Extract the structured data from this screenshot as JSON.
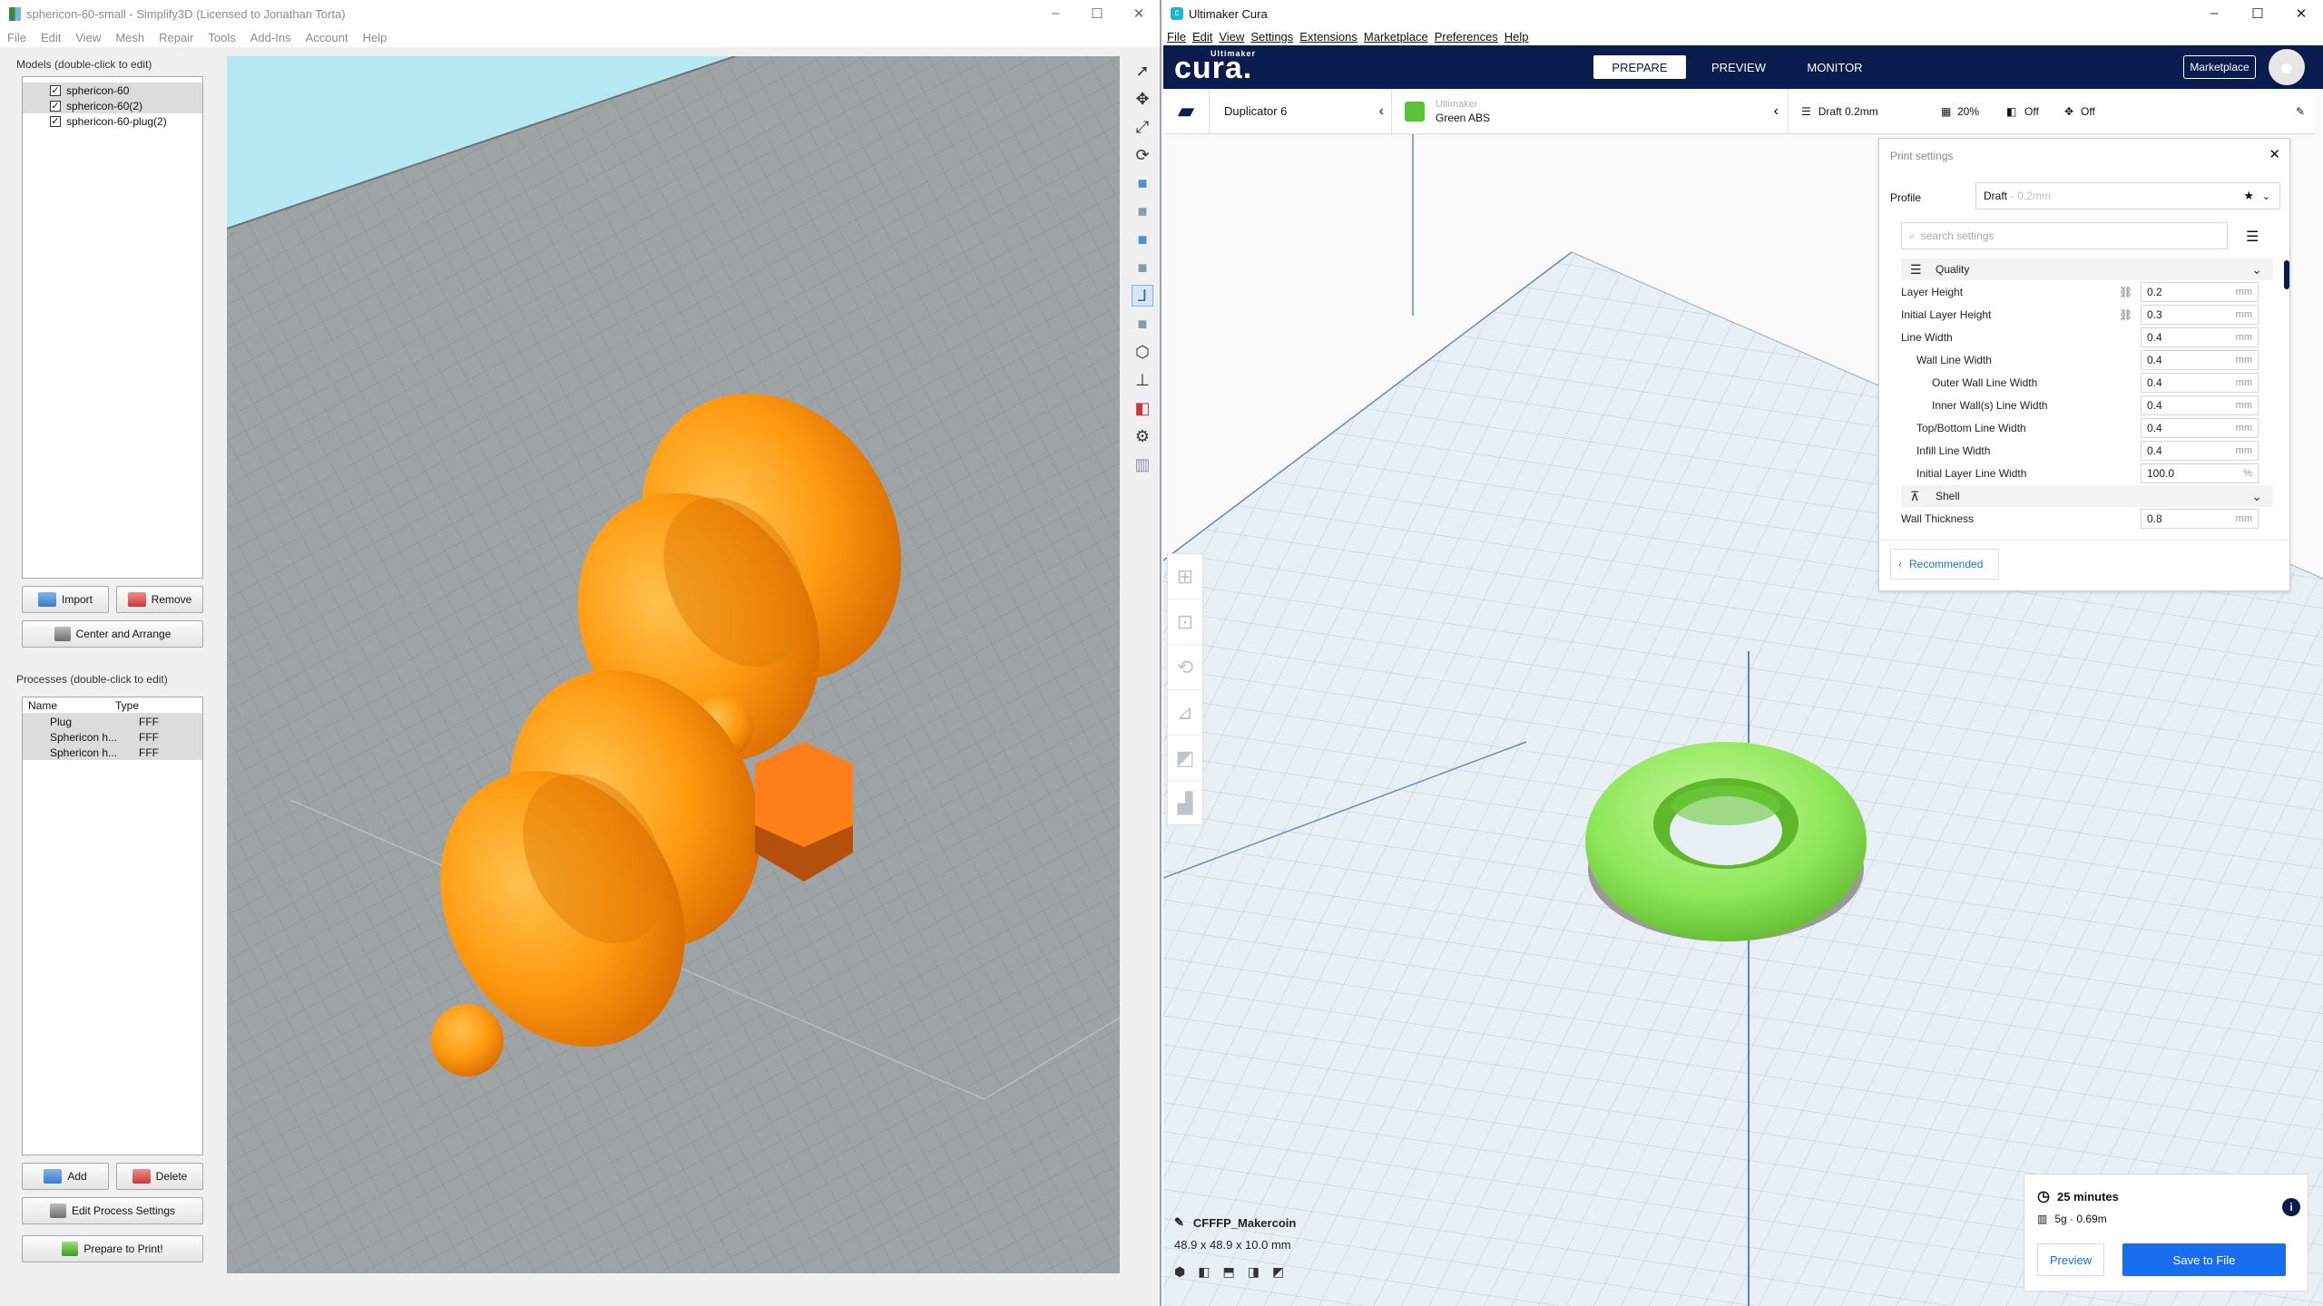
{
  "simplify3d": {
    "title": "sphericon-60-small - Simplify3D (Licensed to Jonathan Torta)",
    "menu": [
      "File",
      "Edit",
      "View",
      "Mesh",
      "Repair",
      "Tools",
      "Add-Ins",
      "Account",
      "Help"
    ],
    "models_label": "Models (double-click to edit)",
    "models": [
      {
        "name": "sphericon-60",
        "checked": "✓"
      },
      {
        "name": "sphericon-60(2)",
        "checked": "✓"
      },
      {
        "name": "sphericon-60-plug(2)",
        "checked": "✓"
      }
    ],
    "buttons": {
      "import": "Import",
      "remove": "Remove",
      "center_arrange": "Center and Arrange",
      "add": "Add",
      "delete": "Delete",
      "edit_process": "Edit Process Settings",
      "prepare": "Prepare to Print!"
    },
    "processes_label": "Processes (double-click to edit)",
    "process_columns": [
      "Name",
      "Type"
    ],
    "processes": [
      {
        "name": "Plug",
        "type": "FFF"
      },
      {
        "name": "Sphericon h...",
        "type": "FFF"
      },
      {
        "name": "Sphericon h...",
        "type": "FFF"
      }
    ]
  },
  "cura": {
    "title": "Ultimaker Cura",
    "menu": [
      "File",
      "Edit",
      "View",
      "Settings",
      "Extensions",
      "Marketplace",
      "Preferences",
      "Help"
    ],
    "logo_brand": "Ultimaker",
    "logo": "cura.",
    "tabs": [
      "PREPARE",
      "PREVIEW",
      "MONITOR"
    ],
    "marketplace": "Marketplace",
    "printer": "Duplicator 6",
    "material_brand": "Ultimaker",
    "material": "Green ABS",
    "profile_summary": "Draft 0.2mm",
    "infill": "20%",
    "support": "Off",
    "adhesion": "Off",
    "print_settings": {
      "title": "Print settings",
      "profile_label": "Profile",
      "profile_value": "Draft",
      "profile_suffix": "- 0.2mm",
      "search_placeholder": "search settings",
      "recommended": "Recommended",
      "categories": {
        "quality": "Quality",
        "shell": "Shell"
      },
      "settings": [
        {
          "label": "Layer Height",
          "value": "0.2",
          "unit": "mm",
          "indent": 0,
          "link": true
        },
        {
          "label": "Initial Layer Height",
          "value": "0.3",
          "unit": "mm",
          "indent": 0,
          "link": true
        },
        {
          "label": "Line Width",
          "value": "0.4",
          "unit": "mm",
          "indent": 0
        },
        {
          "label": "Wall Line Width",
          "value": "0.4",
          "unit": "mm",
          "indent": 1
        },
        {
          "label": "Outer Wall Line Width",
          "value": "0.4",
          "unit": "mm",
          "indent": 2
        },
        {
          "label": "Inner Wall(s) Line Width",
          "value": "0.4",
          "unit": "mm",
          "indent": 2
        },
        {
          "label": "Top/Bottom Line Width",
          "value": "0.4",
          "unit": "mm",
          "indent": 1
        },
        {
          "label": "Infill Line Width",
          "value": "0.4",
          "unit": "mm",
          "indent": 1
        },
        {
          "label": "Initial Layer Line Width",
          "value": "100.0",
          "unit": "%",
          "indent": 1
        }
      ],
      "shell_settings": [
        {
          "label": "Wall Thickness",
          "value": "0.8",
          "unit": "mm"
        }
      ]
    },
    "object": {
      "name": "CFFFP_Makercoin",
      "dims": "48.9 x 48.9 x 10.0 mm"
    },
    "estimate": {
      "time": "25 minutes",
      "material": "5g · 0.69m"
    },
    "actions": {
      "preview": "Preview",
      "save": "Save to File"
    }
  },
  "colors": {
    "cura_blue": "#196ef0",
    "cura_navy": "#0a1b4d",
    "model_orange": "#ff9a10",
    "model_green": "#8ee85a"
  }
}
